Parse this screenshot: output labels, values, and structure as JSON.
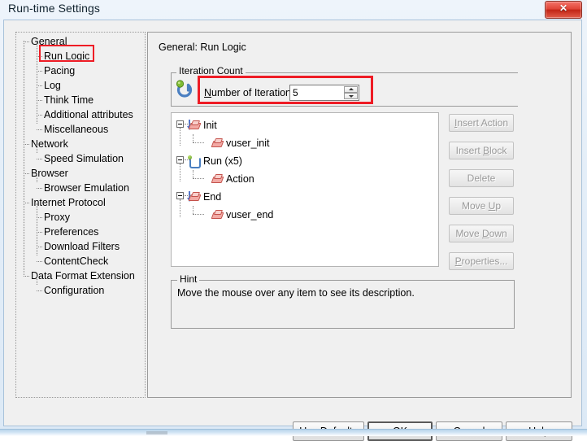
{
  "window": {
    "title": "Run-time Settings",
    "close_glyph": "✕"
  },
  "sidebar": {
    "items": [
      {
        "label": "General",
        "level": 0,
        "highlighted": false
      },
      {
        "label": "Run Logic",
        "level": 1,
        "highlighted": true
      },
      {
        "label": "Pacing",
        "level": 1,
        "highlighted": false
      },
      {
        "label": "Log",
        "level": 1,
        "highlighted": false
      },
      {
        "label": "Think Time",
        "level": 1,
        "highlighted": false
      },
      {
        "label": "Additional attributes",
        "level": 1,
        "highlighted": false
      },
      {
        "label": "Miscellaneous",
        "level": 1,
        "highlighted": false
      },
      {
        "label": "Network",
        "level": 0,
        "highlighted": false
      },
      {
        "label": "Speed Simulation",
        "level": 1,
        "highlighted": false
      },
      {
        "label": "Browser",
        "level": 0,
        "highlighted": false
      },
      {
        "label": "Browser Emulation",
        "level": 1,
        "highlighted": false
      },
      {
        "label": "Internet Protocol",
        "level": 0,
        "highlighted": false
      },
      {
        "label": "Proxy",
        "level": 1,
        "highlighted": false
      },
      {
        "label": "Preferences",
        "level": 1,
        "highlighted": false
      },
      {
        "label": "Download Filters",
        "level": 1,
        "highlighted": false
      },
      {
        "label": "ContentCheck",
        "level": 1,
        "highlighted": false
      },
      {
        "label": "Data Format Extension",
        "level": 0,
        "highlighted": false
      },
      {
        "label": "Configuration",
        "level": 1,
        "highlighted": false
      }
    ]
  },
  "content": {
    "group_title": "General: Run Logic",
    "iteration_count": {
      "group_title": "Iteration Count",
      "field_label_prefix": "N",
      "field_label_rest": "umber of Iterations:",
      "value": "5",
      "icon": "loop-icon"
    },
    "run_logic_tree": [
      {
        "label": "Init",
        "level": 0,
        "icon": "init-block-icon",
        "expander": "minus"
      },
      {
        "label": "vuser_init",
        "level": 1,
        "icon": "action-block-icon",
        "expander": "none"
      },
      {
        "label": "Run (x5)",
        "level": 0,
        "icon": "loop-icon",
        "expander": "minus"
      },
      {
        "label": "Action",
        "level": 1,
        "icon": "action-block-icon",
        "expander": "none"
      },
      {
        "label": "End",
        "level": 0,
        "icon": "end-block-icon",
        "expander": "minus"
      },
      {
        "label": "vuser_end",
        "level": 1,
        "icon": "action-block-icon",
        "expander": "none"
      }
    ],
    "action_buttons": [
      {
        "id": "insert-action",
        "pre": "",
        "accel": "I",
        "post": "nsert Action",
        "enabled": false
      },
      {
        "id": "insert-block",
        "pre": "Insert ",
        "accel": "B",
        "post": "lock",
        "enabled": false
      },
      {
        "id": "delete",
        "pre": "Delete",
        "accel": "",
        "post": "",
        "enabled": false
      },
      {
        "id": "move-up",
        "pre": "Move ",
        "accel": "U",
        "post": "p",
        "enabled": false
      },
      {
        "id": "move-down",
        "pre": "Move ",
        "accel": "D",
        "post": "own",
        "enabled": false
      },
      {
        "id": "properties",
        "pre": "",
        "accel": "P",
        "post": "roperties...",
        "enabled": false
      }
    ],
    "hint": {
      "title": "Hint",
      "text": "Move the mouse over any item to see its description."
    }
  },
  "footer": {
    "buttons": [
      {
        "id": "use-defaults",
        "pre": "U",
        "accel_char": "",
        "post": "se Defaults",
        "default": false
      },
      {
        "id": "ok",
        "pre": "OK",
        "accel_char": "",
        "post": "",
        "default": true
      },
      {
        "id": "cancel",
        "pre": "Cancel",
        "accel_char": "",
        "post": "",
        "default": false
      },
      {
        "id": "help",
        "pre": "H",
        "accel_char": "",
        "post": "elp",
        "default": false
      }
    ]
  },
  "annotations": {
    "color": "#ee1c25",
    "boxes": [
      {
        "name": "sidebar-run-logic-highlight",
        "target": "Run Logic"
      },
      {
        "name": "iterations-field-highlight",
        "target": "Number of Iterations"
      }
    ]
  }
}
